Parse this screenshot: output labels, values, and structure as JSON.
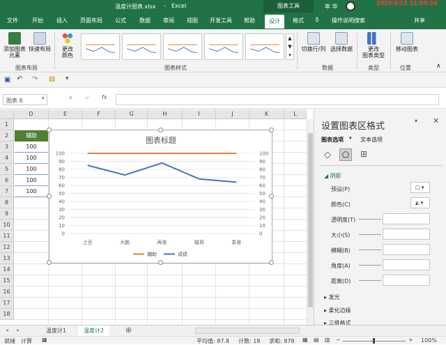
{
  "titlebar": {
    "filename": "温度计图表.xlsx",
    "sep": "-",
    "app": "Excel",
    "context_tab": "图表工具",
    "user": "年 华",
    "timestamp": "2020/4/15 11:09:36"
  },
  "tabs": [
    "文件",
    "开始",
    "插入",
    "页面布局",
    "公式",
    "数据",
    "审阅",
    "视图",
    "开发工具",
    "帮助",
    "设计",
    "格式"
  ],
  "tell_me": "操作说明搜索",
  "share": "共享",
  "ribbon": {
    "add_element": "添加图表\n元素",
    "quick_layout": "快速布局",
    "group_layout": "图表布局",
    "change_color": "更改\n颜色",
    "group_styles": "图表样式",
    "switch_rowcol": "切换行/列",
    "select_data": "选择数据",
    "group_data": "数据",
    "change_type": "更改\n图表类型",
    "group_type": "类型",
    "move_chart": "移动图表",
    "group_location": "位置"
  },
  "formula": {
    "namebox": "图表 8",
    "cancel": "✕",
    "confirm": "✓",
    "fx": "fx",
    "value": ""
  },
  "columns": [
    "D",
    "E",
    "F",
    "G",
    "H",
    "I",
    "J",
    "K",
    "L"
  ],
  "rows": [
    "1",
    "2",
    "3",
    "4",
    "5",
    "6",
    "7",
    "8",
    "9",
    "10",
    "11",
    "12",
    "13",
    "14",
    "15",
    "16",
    "17",
    "18"
  ],
  "cells": {
    "header": "辅助",
    "values": [
      "100",
      "100",
      "100",
      "100",
      "100"
    ]
  },
  "chart_data": {
    "type": "line",
    "title": "图表标题",
    "categories": [
      "土豆",
      "大鹏",
      "再夜",
      "猫哥",
      "黍食"
    ],
    "series": [
      {
        "name": "辅助",
        "values": [
          100,
          100,
          100,
          100,
          100
        ],
        "color": "#ED7D31"
      },
      {
        "name": "成绩",
        "values": [
          85,
          73,
          88,
          68,
          64
        ],
        "color": "#4472C4"
      }
    ],
    "ylim": [
      0,
      100
    ],
    "yticks": [
      "0",
      "10",
      "20",
      "30",
      "40",
      "50",
      "60",
      "70",
      "80",
      "90",
      "100"
    ],
    "secondary_axis": true,
    "legend": "bottom"
  },
  "pane": {
    "title": "设置图表区格式",
    "tab1": "图表选项",
    "tab2": "文本选项",
    "section_shadow": "阴影",
    "preset": "预设(P)",
    "color": "颜色(C)",
    "transparency": "透明度(T)",
    "size": "大小(S)",
    "blur": "模糊(B)",
    "angle": "角度(A)",
    "distance": "距离(D)",
    "section_glow": "发光",
    "section_soft": "柔化边缘",
    "section_3d": "三维格式"
  },
  "sheets": [
    "温度计1",
    "温度计2"
  ],
  "status": {
    "mode": "就绪",
    "calc": "计算",
    "average": "平均值: 87.8",
    "count": "计数: 18",
    "sum": "求和: 878",
    "zoom": "100%"
  }
}
